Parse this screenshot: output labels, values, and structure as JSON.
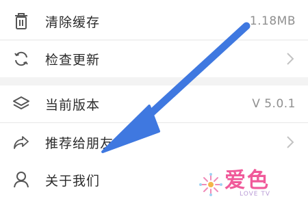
{
  "settings": {
    "items": [
      {
        "label": "清除缓存",
        "value": "1.18MB",
        "icon": "trash-icon"
      },
      {
        "label": "检查更新",
        "icon": "refresh-icon",
        "chevron": "chevron-right-icon"
      },
      {
        "label": "当前版本",
        "value": "V 5.0.1",
        "icon": "layers-icon"
      },
      {
        "label": "推荐给朋友",
        "icon": "share-icon",
        "chevron": "chevron-right-icon"
      },
      {
        "label": "关于我们",
        "icon": "user-icon"
      }
    ]
  },
  "watermark": {
    "logo_text": "爱色",
    "logo_sub": "LOVE TV"
  },
  "colors": {
    "arrow": "#3f78e0",
    "divider": "#e6e6e6",
    "gap": "#f3f3f3",
    "logo": "#f05a9a"
  }
}
